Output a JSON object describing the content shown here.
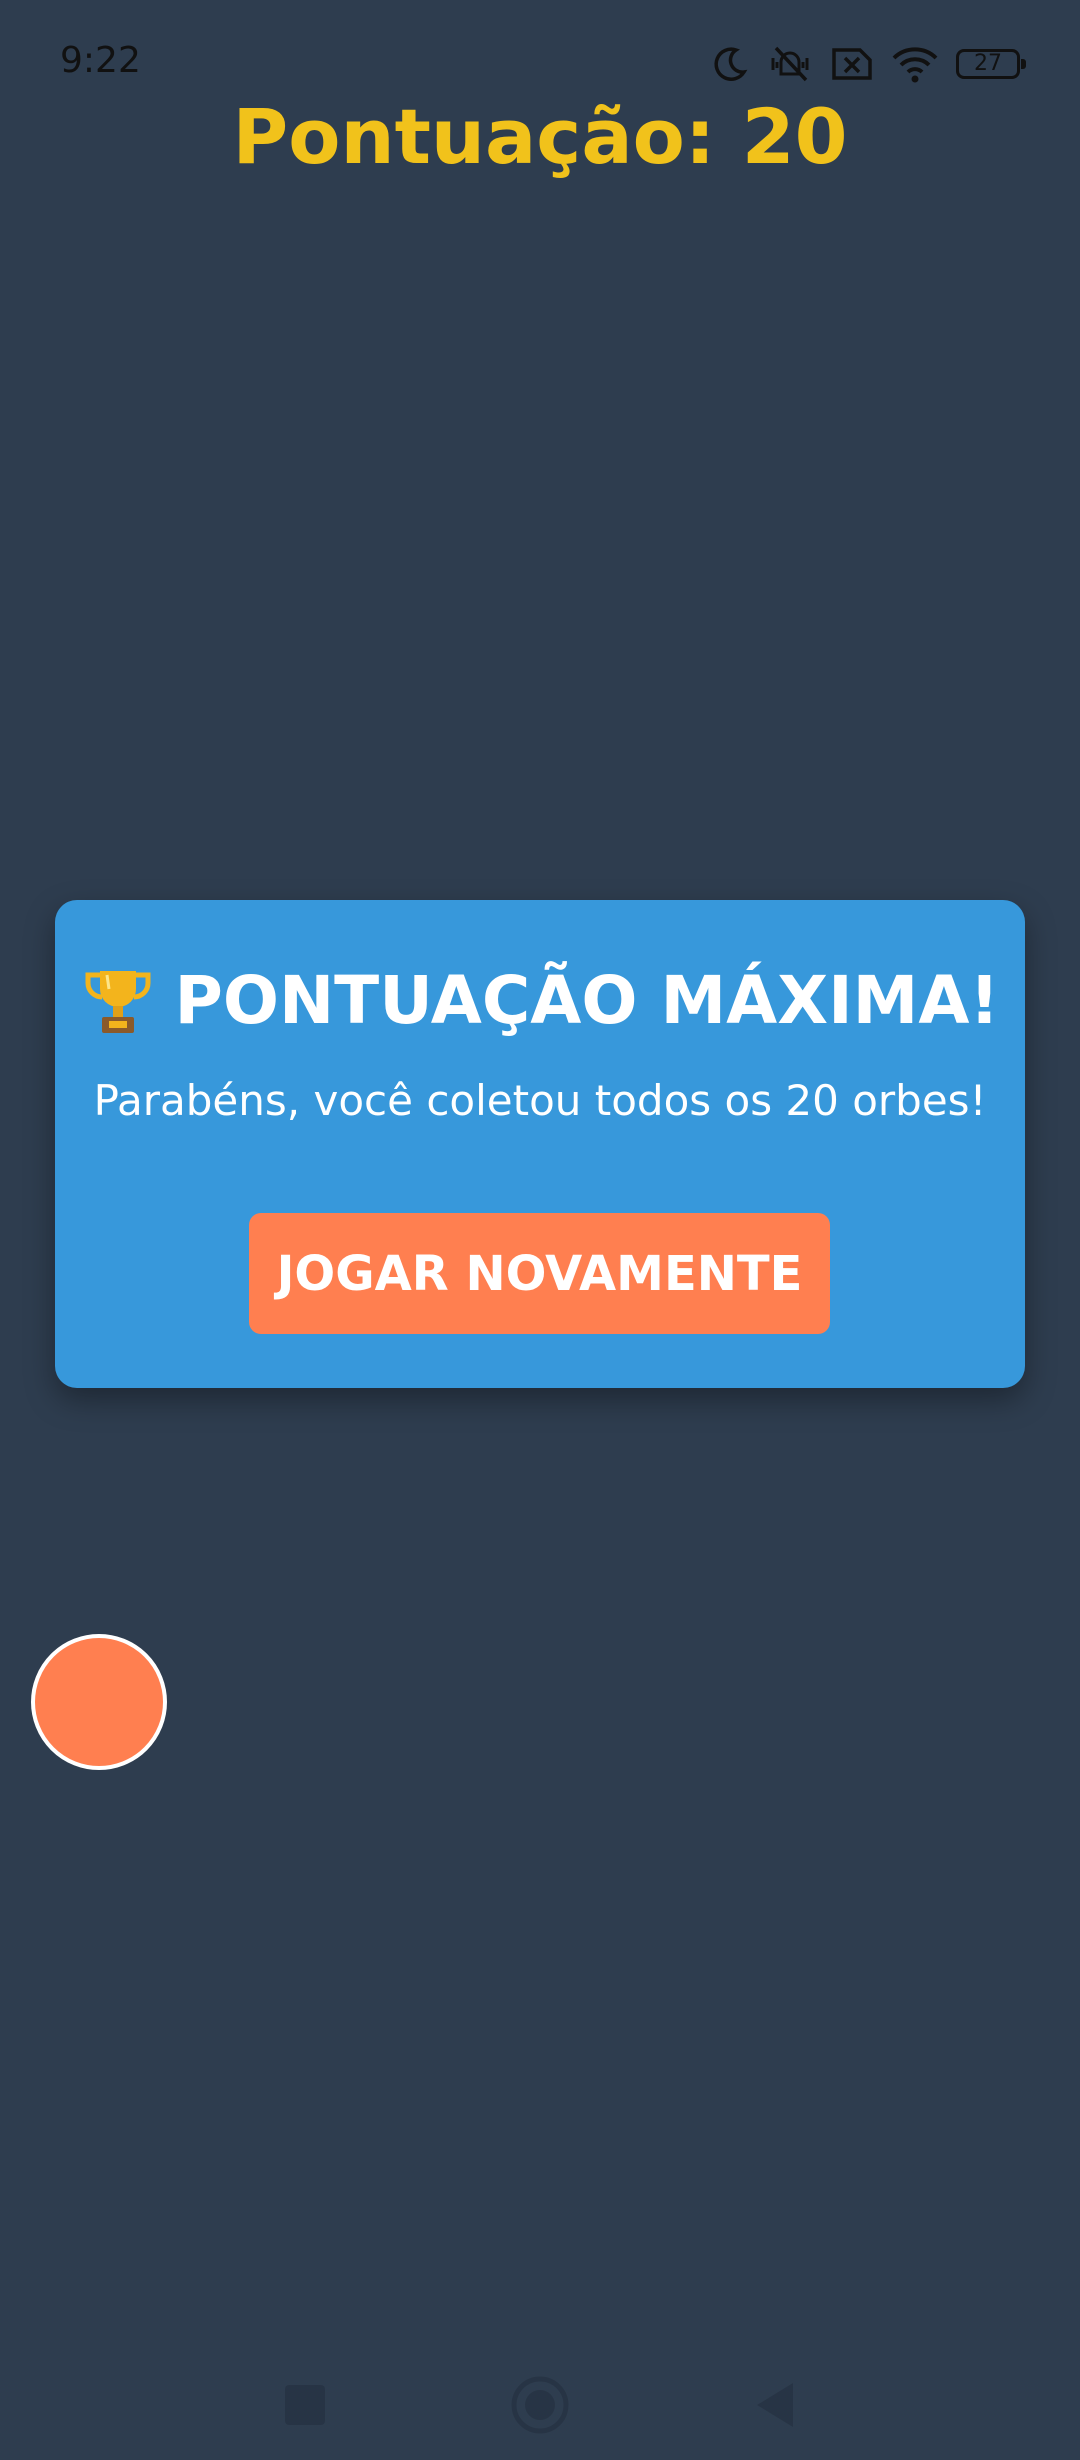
{
  "status_bar": {
    "time": "9:22",
    "battery": "27",
    "icons": [
      "moon-icon",
      "vibrate-off-icon",
      "no-sim-icon",
      "wifi-icon",
      "battery-icon"
    ]
  },
  "game": {
    "score_text": "Pontuação: 20",
    "score_color": "#f1c21b"
  },
  "modal": {
    "title": "PONTUAÇÃO MÁXIMA!",
    "title_icon": "trophy-icon",
    "message": "Parabéns, você coletou todos os 20 orbes!",
    "button_label": "JOGAR NOVAMENTE",
    "background": "#3798db",
    "button_color": "#ff7f50"
  },
  "player": {
    "color": "#ff7f50"
  },
  "nav_bar": {
    "icons": [
      "square-icon",
      "circle-home-icon",
      "back-triangle-icon"
    ]
  },
  "colors": {
    "background": "#2e3d4f"
  }
}
